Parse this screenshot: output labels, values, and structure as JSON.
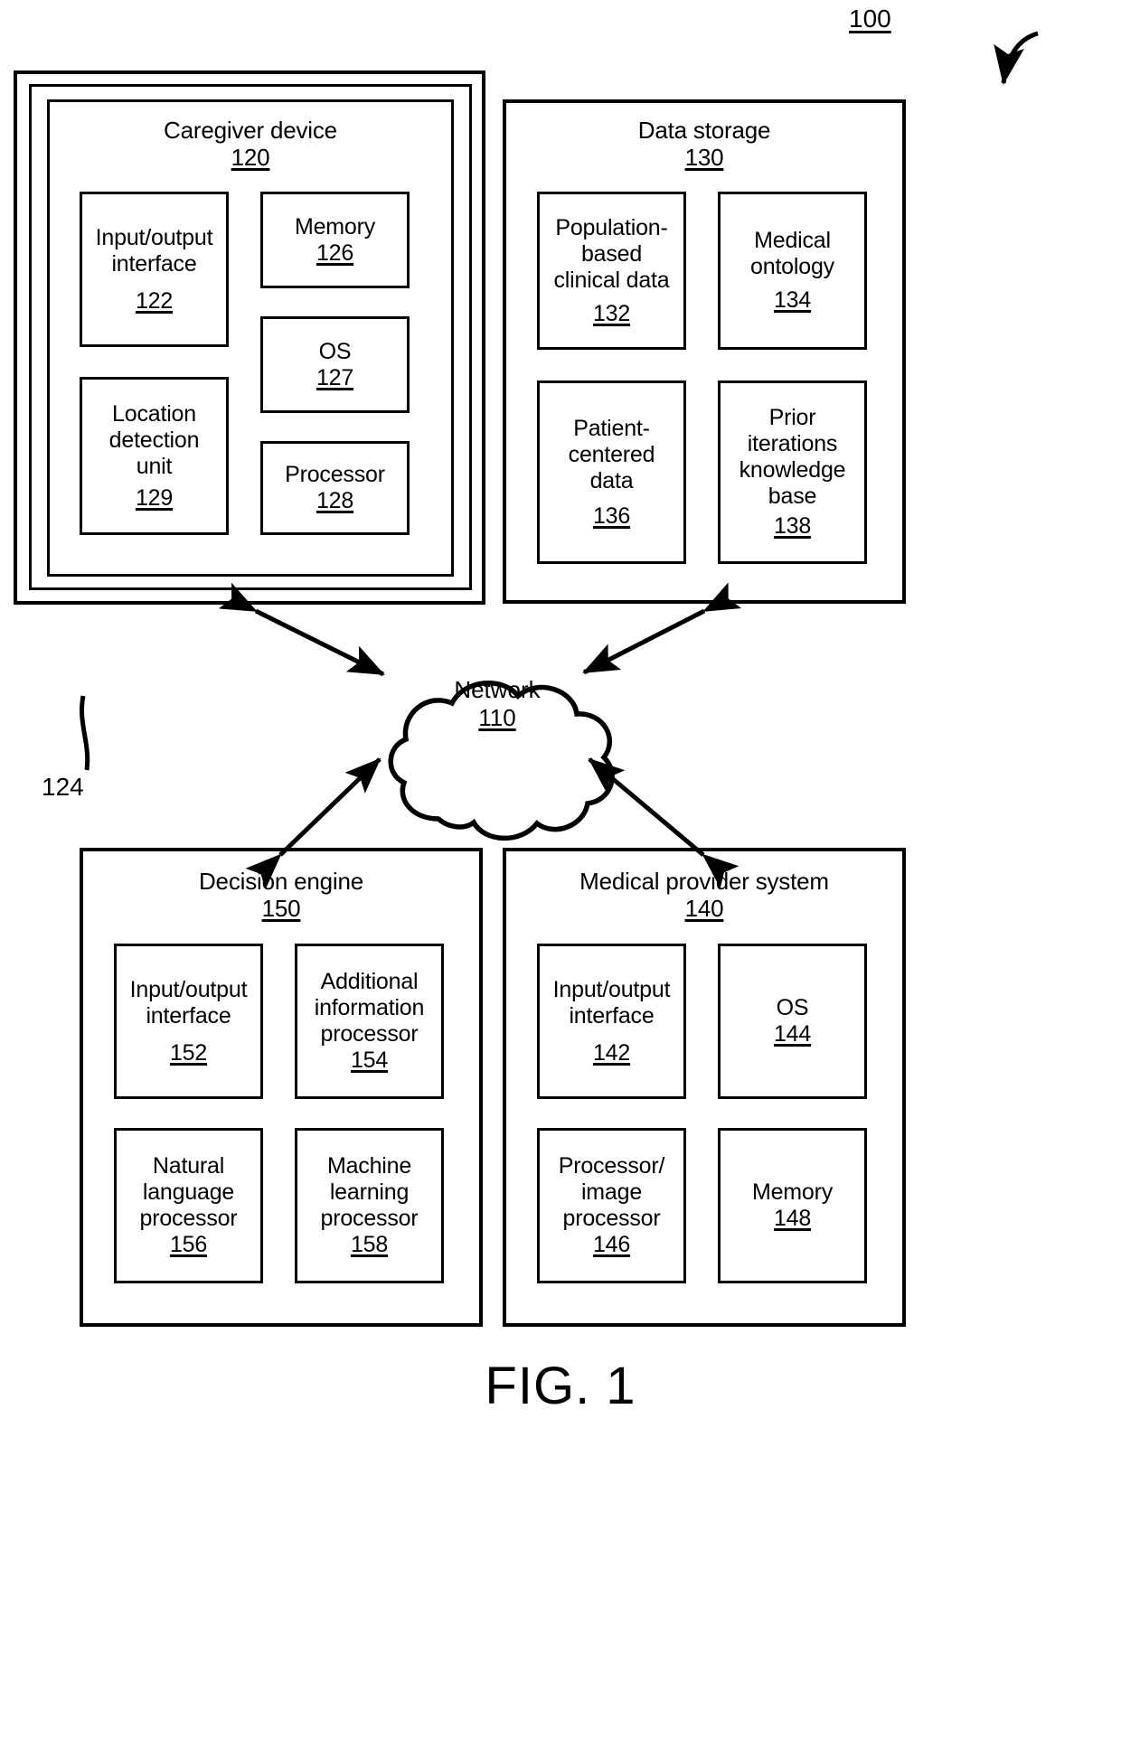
{
  "figure": {
    "caption": "FIG. 1",
    "system_ref": "100",
    "bus_ref": "124"
  },
  "network": {
    "label": "Network",
    "ref": "110"
  },
  "caregiver_device": {
    "title": "Caregiver device",
    "ref": "120",
    "components": [
      {
        "label": "Input/output\ninterface",
        "ref": "122"
      },
      {
        "label": "Memory",
        "ref": "126"
      },
      {
        "label": "OS",
        "ref": "127"
      },
      {
        "label": "Location\ndetection\nunit",
        "ref": "129"
      },
      {
        "label": "Processor",
        "ref": "128"
      }
    ]
  },
  "data_storage": {
    "title": "Data storage",
    "ref": "130",
    "components": [
      {
        "label": "Population-\nbased\nclinical data",
        "ref": "132"
      },
      {
        "label": "Medical\nontology",
        "ref": "134"
      },
      {
        "label": "Patient-\ncentered\ndata",
        "ref": "136"
      },
      {
        "label": "Prior\niterations\nknowledge\nbase",
        "ref": "138"
      }
    ]
  },
  "decision_engine": {
    "title": "Decision engine",
    "ref": "150",
    "components": [
      {
        "label": "Input/output\ninterface",
        "ref": "152"
      },
      {
        "label": "Additional\ninformation\nprocessor",
        "ref": "154"
      },
      {
        "label": "Natural\nlanguage\nprocessor",
        "ref": "156"
      },
      {
        "label": "Machine\nlearning\nprocessor",
        "ref": "158"
      }
    ]
  },
  "medical_provider_system": {
    "title": "Medical provider system",
    "ref": "140",
    "components": [
      {
        "label": "Input/output\ninterface",
        "ref": "142"
      },
      {
        "label": "OS",
        "ref": "144"
      },
      {
        "label": "Processor/\nimage\nprocessor",
        "ref": "146"
      },
      {
        "label": "Memory",
        "ref": "148"
      }
    ]
  },
  "colors": {
    "stroke": "#000000",
    "background": "#ffffff"
  }
}
